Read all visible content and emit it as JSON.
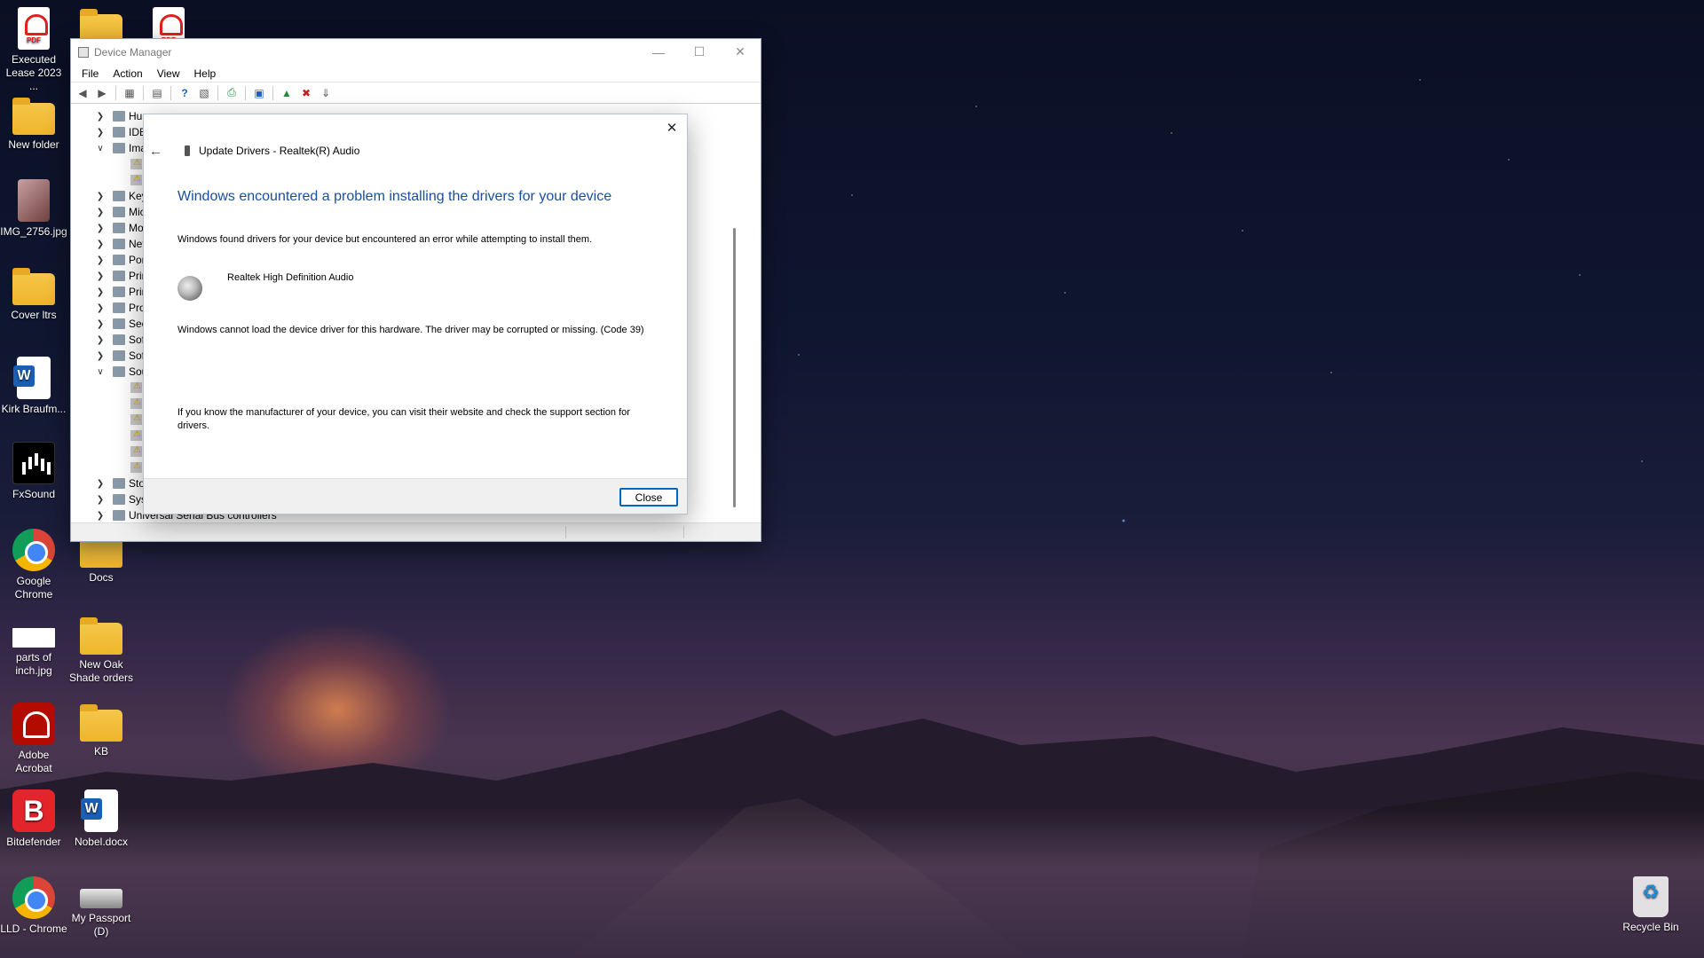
{
  "desktop": {
    "icons": [
      {
        "label": "Executed Lease 2023 ..."
      },
      {
        "label": "New folder"
      },
      {
        "label": "IMG_2756.jpg"
      },
      {
        "label": "Cover ltrs"
      },
      {
        "label": "Kirk Braufm..."
      },
      {
        "label": "FxSound"
      },
      {
        "label": "Google Chrome"
      },
      {
        "label": "Docs"
      },
      {
        "label": "parts of inch.jpg"
      },
      {
        "label": "New Oak Shade orders"
      },
      {
        "label": "Adobe Acrobat"
      },
      {
        "label": "KB"
      },
      {
        "label": "Bitdefender"
      },
      {
        "label": "Nobel.docx"
      },
      {
        "label": "LLD - Chrome"
      },
      {
        "label": "My Passport (D)"
      },
      {
        "label": "Recycle Bin"
      }
    ]
  },
  "device_manager": {
    "title": "Device Manager",
    "menu": [
      "File",
      "Action",
      "View",
      "Help"
    ],
    "tree": [
      {
        "label": "Hur",
        "expanded": false
      },
      {
        "label": "IDE",
        "expanded": false
      },
      {
        "label": "Ima",
        "expanded": true
      },
      {
        "label": "Key",
        "expanded": false
      },
      {
        "label": "Mic",
        "expanded": false
      },
      {
        "label": "Mo",
        "expanded": false
      },
      {
        "label": "Net",
        "expanded": false
      },
      {
        "label": "Por",
        "expanded": false
      },
      {
        "label": "Prir",
        "expanded": false
      },
      {
        "label": "Prir",
        "expanded": false
      },
      {
        "label": "Pro",
        "expanded": false
      },
      {
        "label": "Sec",
        "expanded": false
      },
      {
        "label": "Soft",
        "expanded": false
      },
      {
        "label": "Soft",
        "expanded": false
      },
      {
        "label": "Sou",
        "expanded": true
      },
      {
        "label": "Stor",
        "expanded": false
      },
      {
        "label": "Syst",
        "expanded": false
      },
      {
        "label": "Universal Serial Bus controllers",
        "expanded": false
      }
    ]
  },
  "dialog": {
    "title": "Update Drivers - Realtek(R) Audio",
    "heading": "Windows encountered a problem installing the drivers for your device",
    "found_text": "Windows found drivers for your device but encountered an error while attempting to install them.",
    "device_name": "Realtek High Definition Audio",
    "error_text": "Windows cannot load the device driver for this hardware. The driver may be corrupted or missing. (Code 39)",
    "support_text": "If you know the manufacturer of your device, you can visit their website and check the support section for drivers.",
    "close_button": "Close"
  }
}
